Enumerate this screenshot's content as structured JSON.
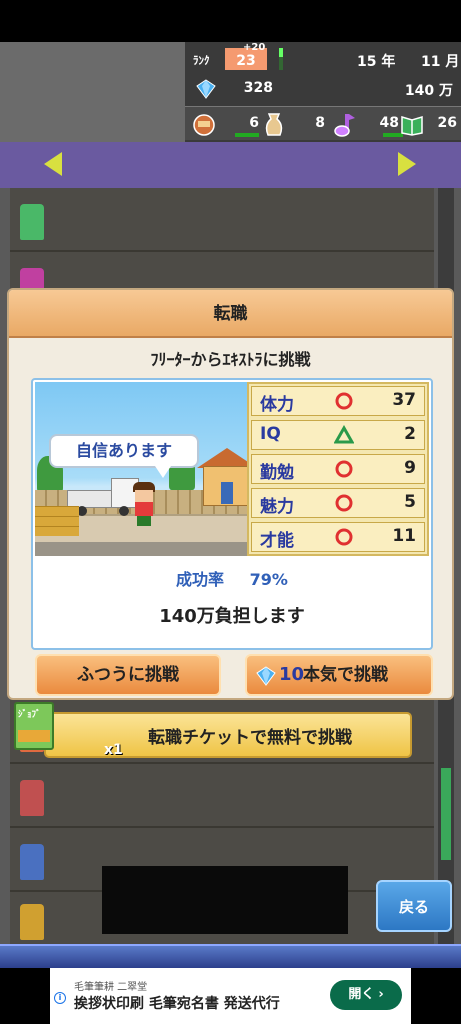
{
  "hud": {
    "rank_label": "ﾗﾝｸ",
    "rank_value": "23",
    "rank_bonus": "+20",
    "year": "15 年",
    "month": "11 月",
    "gems": "328",
    "money": "140 万",
    "resources": [
      {
        "icon": "food-icon",
        "value": "6"
      },
      {
        "icon": "sack-icon",
        "value": "8"
      },
      {
        "icon": "music-note-icon",
        "value": "48"
      },
      {
        "icon": "book-icon",
        "value": "26"
      }
    ]
  },
  "dialog": {
    "title": "転職",
    "subtitle": "ﾌﾘｰﾀｰからｴｷｽﾄﾗに挑戦",
    "speech_bubble": "自信あります",
    "stats": [
      {
        "name": "体力",
        "grade": "circle",
        "value": "37"
      },
      {
        "name": "IQ",
        "grade": "triangle",
        "value": "2"
      },
      {
        "name": "勤勉",
        "grade": "circle",
        "value": "9"
      },
      {
        "name": "魅力",
        "grade": "circle",
        "value": "5"
      },
      {
        "name": "才能",
        "grade": "circle",
        "value": "11"
      }
    ],
    "success_label": "成功率",
    "success_value": "79%",
    "cost_text": "140万負担します",
    "btn_normal": "ふつうに挑戦",
    "btn_serious_cost": "10",
    "btn_serious_label": "本気で挑戦"
  },
  "ticket": {
    "icon_text": "ｼﾞｮﾌﾞ",
    "count": "x1",
    "label": "転職チケットで無料で挑戦"
  },
  "back_button": "戻る",
  "ad": {
    "sponsor": "毛筆筆耕 二翠堂",
    "title": "挨拶状印刷 毛筆宛名書 発送代行",
    "cta": "開く"
  },
  "colors": {
    "accent_orange": "#ea8a3e",
    "stat_blue": "#2a3aa0",
    "grade_circle": "#e03030",
    "grade_triangle": "#2a9a4a",
    "back_blue": "#2d78c4"
  }
}
